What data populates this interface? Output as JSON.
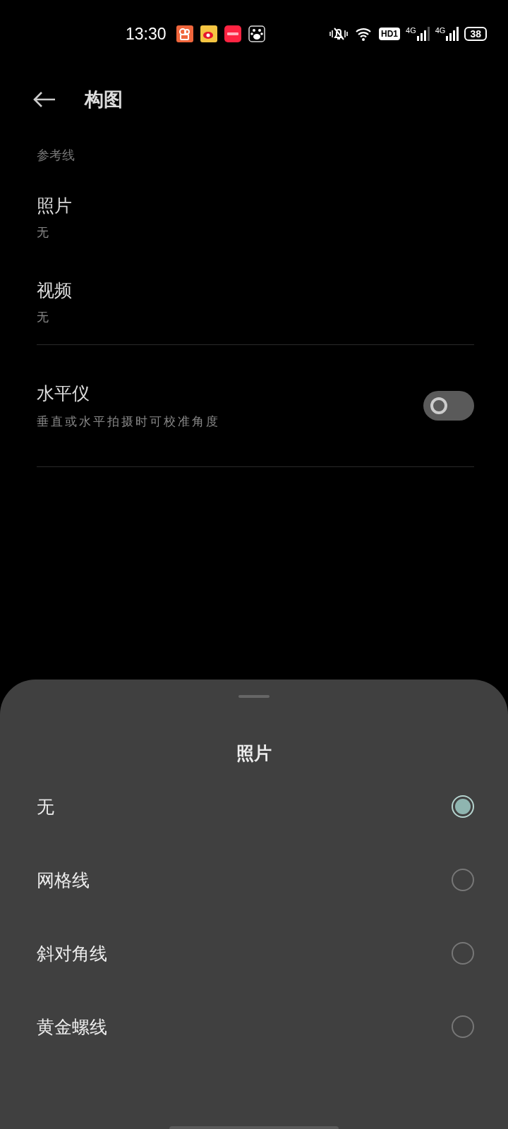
{
  "status_bar": {
    "time": "13:30",
    "hd_badge": "HD1",
    "sims": [
      {
        "label": "4G"
      },
      {
        "label": "4G"
      }
    ],
    "battery": "38"
  },
  "header": {
    "title": "构图"
  },
  "section": {
    "title": "参考线"
  },
  "items": [
    {
      "title": "照片",
      "value": "无"
    },
    {
      "title": "视频",
      "value": "无"
    }
  ],
  "level_setting": {
    "title": "水平仪",
    "description": "垂直或水平拍摄时可校准角度",
    "on": false
  },
  "sheet": {
    "title": "照片",
    "options": [
      {
        "label": "无",
        "selected": true
      },
      {
        "label": "网格线",
        "selected": false
      },
      {
        "label": "斜对角线",
        "selected": false
      },
      {
        "label": "黄金螺线",
        "selected": false
      }
    ]
  }
}
